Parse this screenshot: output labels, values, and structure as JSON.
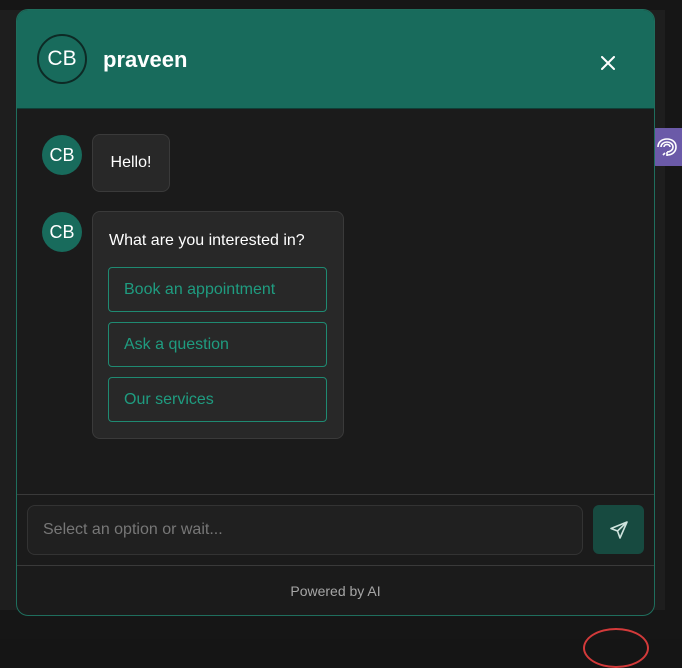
{
  "header": {
    "avatar_initials": "CB",
    "title": "praveen",
    "close_icon": "close-icon",
    "accent_color": "#186b5c"
  },
  "messages": [
    {
      "avatar_initials": "CB",
      "text": "Hello!"
    },
    {
      "avatar_initials": "CB",
      "text": "What are you interested in?",
      "options": [
        "Book an appointment",
        "Ask a question",
        "Our services"
      ]
    }
  ],
  "composer": {
    "placeholder": "Select an option or wait...",
    "value": "",
    "send_icon": "send-icon"
  },
  "footer": {
    "text": "Powered by AI"
  },
  "side_tab": {
    "icon": "brain-icon",
    "color": "#6b5aa8"
  }
}
